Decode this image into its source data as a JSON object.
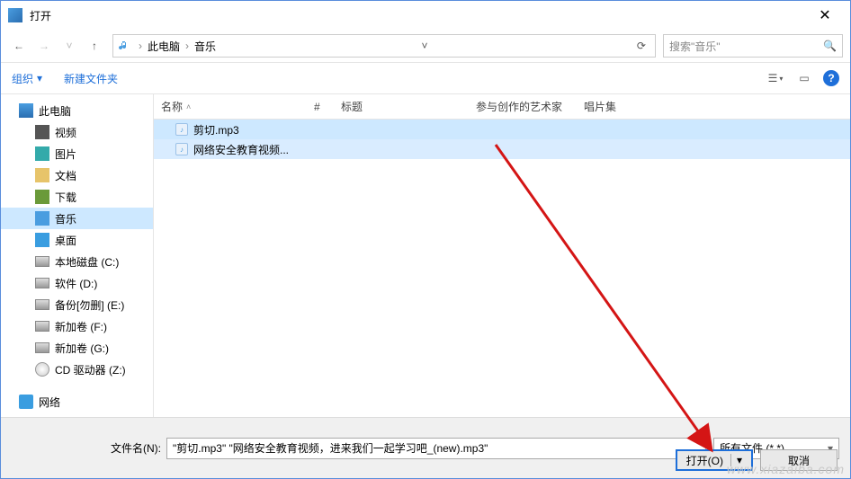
{
  "window": {
    "title": "打开",
    "close_glyph": "✕"
  },
  "nav": {
    "back": "←",
    "forward": "→",
    "dropdown": "˅",
    "up": "↑"
  },
  "address": {
    "crumbs": [
      "此电脑",
      "音乐"
    ],
    "sep": "›",
    "dropdown": "˅",
    "refresh": "⟳"
  },
  "search": {
    "placeholder": "搜索\"音乐\"",
    "icon": "🔍"
  },
  "toolbar": {
    "organize": "组织",
    "new_folder": "新建文件夹",
    "view_icon": "☰",
    "preview_icon": "▭",
    "help_icon": "?"
  },
  "sidebar": {
    "items": [
      {
        "label": "此电脑",
        "iconClass": "ic-pc"
      },
      {
        "label": "视频",
        "iconClass": "ic-vid"
      },
      {
        "label": "图片",
        "iconClass": "ic-pic"
      },
      {
        "label": "文档",
        "iconClass": "ic-doc"
      },
      {
        "label": "下载",
        "iconClass": "ic-dl"
      },
      {
        "label": "音乐",
        "iconClass": "ic-music"
      },
      {
        "label": "桌面",
        "iconClass": "ic-desk"
      },
      {
        "label": "本地磁盘 (C:)",
        "iconClass": "ic-disk"
      },
      {
        "label": "软件 (D:)",
        "iconClass": "ic-disk"
      },
      {
        "label": "备份[勿删] (E:)",
        "iconClass": "ic-disk"
      },
      {
        "label": "新加卷 (F:)",
        "iconClass": "ic-disk"
      },
      {
        "label": "新加卷 (G:)",
        "iconClass": "ic-disk"
      },
      {
        "label": "CD 驱动器 (Z:)",
        "iconClass": "ic-cd"
      }
    ],
    "network": "网络"
  },
  "columns": {
    "name": "名称",
    "num": "#",
    "title": "标题",
    "artist": "参与创作的艺术家",
    "album": "唱片集",
    "sort": "˄"
  },
  "files": [
    {
      "name": "剪切.mp3"
    },
    {
      "name": "网络安全教育视频..."
    }
  ],
  "bottom": {
    "filename_label": "文件名(N):",
    "filename_value": "\"剪切.mp3\" \"网络安全教育视频，进来我们一起学习吧_(new).mp3\"",
    "filter": "所有文件 (*.*)",
    "open": "打开(O)",
    "cancel": "取消",
    "dd": "▾"
  },
  "watermark": "www.xiazaiba.com"
}
